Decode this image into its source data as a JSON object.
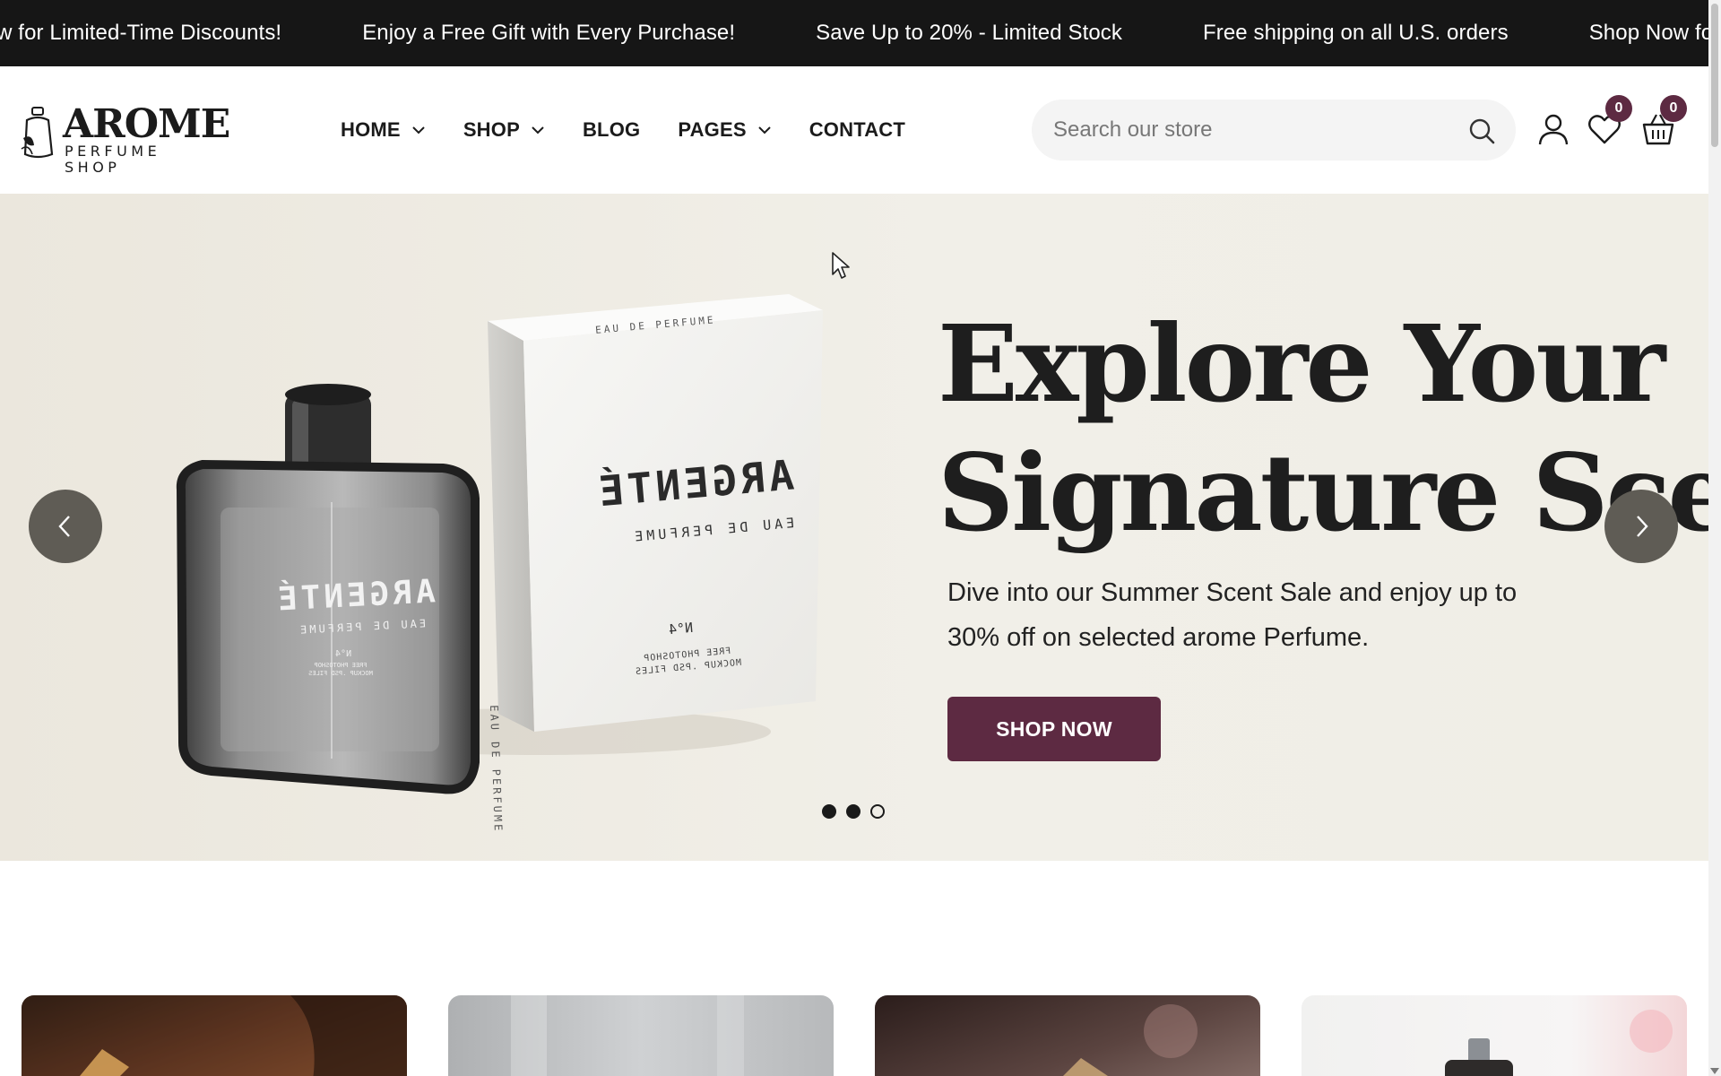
{
  "announcement": {
    "items": [
      "Shop Now for Limited-Time Discounts!",
      "Enjoy a Free Gift with Every Purchase!",
      "Save Up to 20% - Limited Stock",
      "Free shipping on all U.S. orders",
      "Shop Now for Limited-Time Discounts!"
    ]
  },
  "logo": {
    "title": "AROME",
    "subtitle": "PERFUME SHOP"
  },
  "nav": {
    "items": [
      {
        "label": "HOME",
        "has_dropdown": true
      },
      {
        "label": "SHOP",
        "has_dropdown": true
      },
      {
        "label": "BLOG",
        "has_dropdown": false
      },
      {
        "label": "PAGES",
        "has_dropdown": true
      },
      {
        "label": "CONTACT",
        "has_dropdown": false
      }
    ]
  },
  "search": {
    "placeholder": "Search our store",
    "value": "",
    "icon": "search-icon"
  },
  "header_icons": {
    "account_icon": "user-icon",
    "wishlist_icon": "heart-icon",
    "wishlist_count": "0",
    "cart_icon": "basket-icon",
    "cart_count": "0"
  },
  "hero": {
    "heading_line1": "Explore Your",
    "heading_line2": "Signature Scent",
    "description": "Dive into our Summer Scent Sale and enjoy up to 30% off on selected arome Perfume.",
    "cta_label": "SHOP NOW",
    "slide_count": 3,
    "product": {
      "box_brand": "ARGENTÉ",
      "box_line": "EAU DE PERFUME",
      "box_number": "N°4",
      "box_side": "EAU DE PERFUME",
      "box_top": "EAU DE PERFUME",
      "box_note": "FREE PHOTOSHOP MOCKUP .PSD FILES",
      "bottle_brand": "ARGENTÉ",
      "bottle_line": "EAU DE PERFUME",
      "bottle_number": "N°4",
      "bottle_note": "FREE PHOTOSHOP MOCKUP .PSD FILES"
    }
  },
  "colors": {
    "brand": "#5d2a42",
    "announcement_bg": "#161616",
    "hero_bg": "#efece4"
  }
}
